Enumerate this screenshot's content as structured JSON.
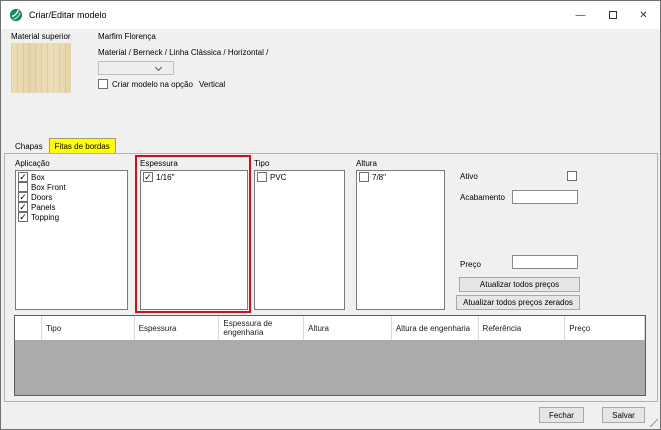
{
  "window": {
    "title": "Criar/Editar modelo"
  },
  "icons": {
    "check": "✓",
    "minimize": "—",
    "close": "✕",
    "chevron_down": "chevron-down",
    "maximize": "restore-square"
  },
  "header": {
    "material_label": "Material superior",
    "material_name": "Marfim Florença",
    "material_path": "Material / Berneck / Linha Clássica / Horizontal /",
    "combo_value": "",
    "create_option_label": "Criar modelo na opção",
    "create_option_value": "Vertical",
    "create_option_checked": false
  },
  "tabs": [
    {
      "label": "Chapas",
      "active": false
    },
    {
      "label": "Fitas de bordas",
      "active": true
    }
  ],
  "panels": {
    "aplicacao": {
      "title": "Aplicação",
      "items": [
        {
          "label": "Box",
          "checked": true
        },
        {
          "label": "Box Front",
          "checked": false
        },
        {
          "label": "Doors",
          "checked": true
        },
        {
          "label": "Panels",
          "checked": true
        },
        {
          "label": "Topping",
          "checked": true
        }
      ]
    },
    "espessura": {
      "title": "Espessura",
      "highlighted": true,
      "items": [
        {
          "label": "1/16\"",
          "checked": true
        }
      ]
    },
    "tipo": {
      "title": "Tipo",
      "items": [
        {
          "label": "PVC",
          "checked": false
        }
      ]
    },
    "altura": {
      "title": "Altura",
      "items": [
        {
          "label": "7/8\"",
          "checked": false
        }
      ]
    }
  },
  "right_panel": {
    "ativo_label": "Ativo",
    "ativo_checked": false,
    "acabamento_label": "Acabamento",
    "acabamento_value": "",
    "preco_label": "Preço",
    "preco_value": "",
    "update_prices_button": "Atualizar todos preços",
    "update_zero_prices_button": "Atualizar todos preços zerados"
  },
  "table": {
    "columns": [
      "",
      "Tipo",
      "Espessura",
      "Espessura de engenharia",
      "Altura",
      "Altura de engenharia",
      "Referência",
      "Preço"
    ],
    "rows": []
  },
  "footer": {
    "close_button": "Fechar",
    "save_button": "Salvar"
  },
  "colors": {
    "highlight_red": "#e30613",
    "tab_highlight": "#ffff00",
    "swatch_beige": "#e9dab2",
    "app_icon_teal": "#1b8470",
    "grid_body_gray": "#ababab"
  }
}
